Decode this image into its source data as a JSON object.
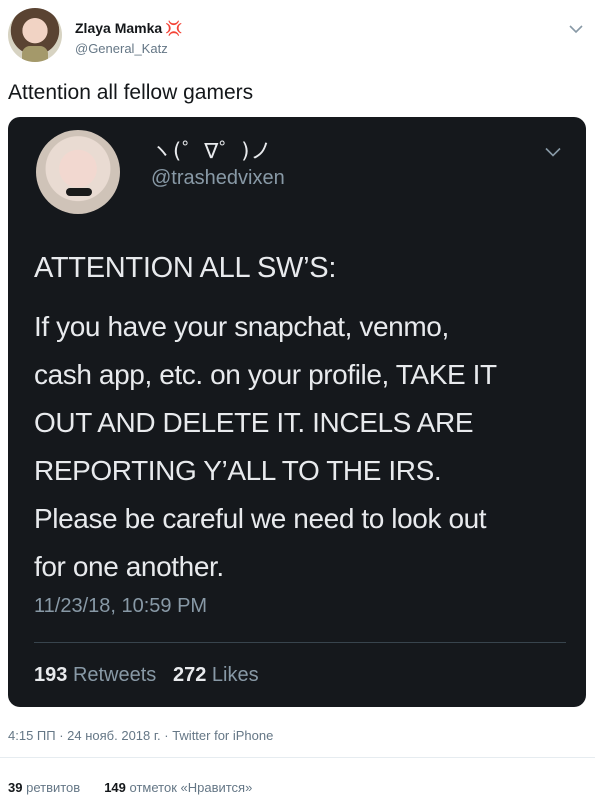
{
  "author": {
    "display_name": "Zlaya Mamka",
    "badge": "💢",
    "handle": "@General_Katz"
  },
  "tweet_text": "Attention all fellow gamers",
  "quoted": {
    "display_name": "ヽ(゜∇゜)ノ",
    "handle": "@trashedvixen",
    "heading": "ATTENTION ALL SW’S:",
    "body_lines": [
      "If you have your snapchat, venmo,",
      "cash app, etc. on your profile, TAKE IT",
      "OUT AND DELETE IT. INCELS ARE",
      "REPORTING Y’ALL TO THE IRS.",
      "Please be careful we need to look out",
      "for one another."
    ],
    "timestamp": "11/23/18, 10:59 PM",
    "retweets_count": "193",
    "retweets_label": "Retweets",
    "likes_count": "272",
    "likes_label": "Likes"
  },
  "meta": "4:15 ПП · 24 нояб. 2018 г. · Twitter for iPhone",
  "stats": {
    "retweets_count": "39",
    "retweets_label": "ретвитов",
    "likes_count": "149",
    "likes_label": "отметок «Нравится»"
  },
  "icons": {
    "outer_menu": "chevron-down-icon",
    "inner_menu": "chevron-down-icon"
  },
  "colors": {
    "card_background": "#15181c",
    "secondary_text": "#657786",
    "badge": "#e0245e"
  }
}
